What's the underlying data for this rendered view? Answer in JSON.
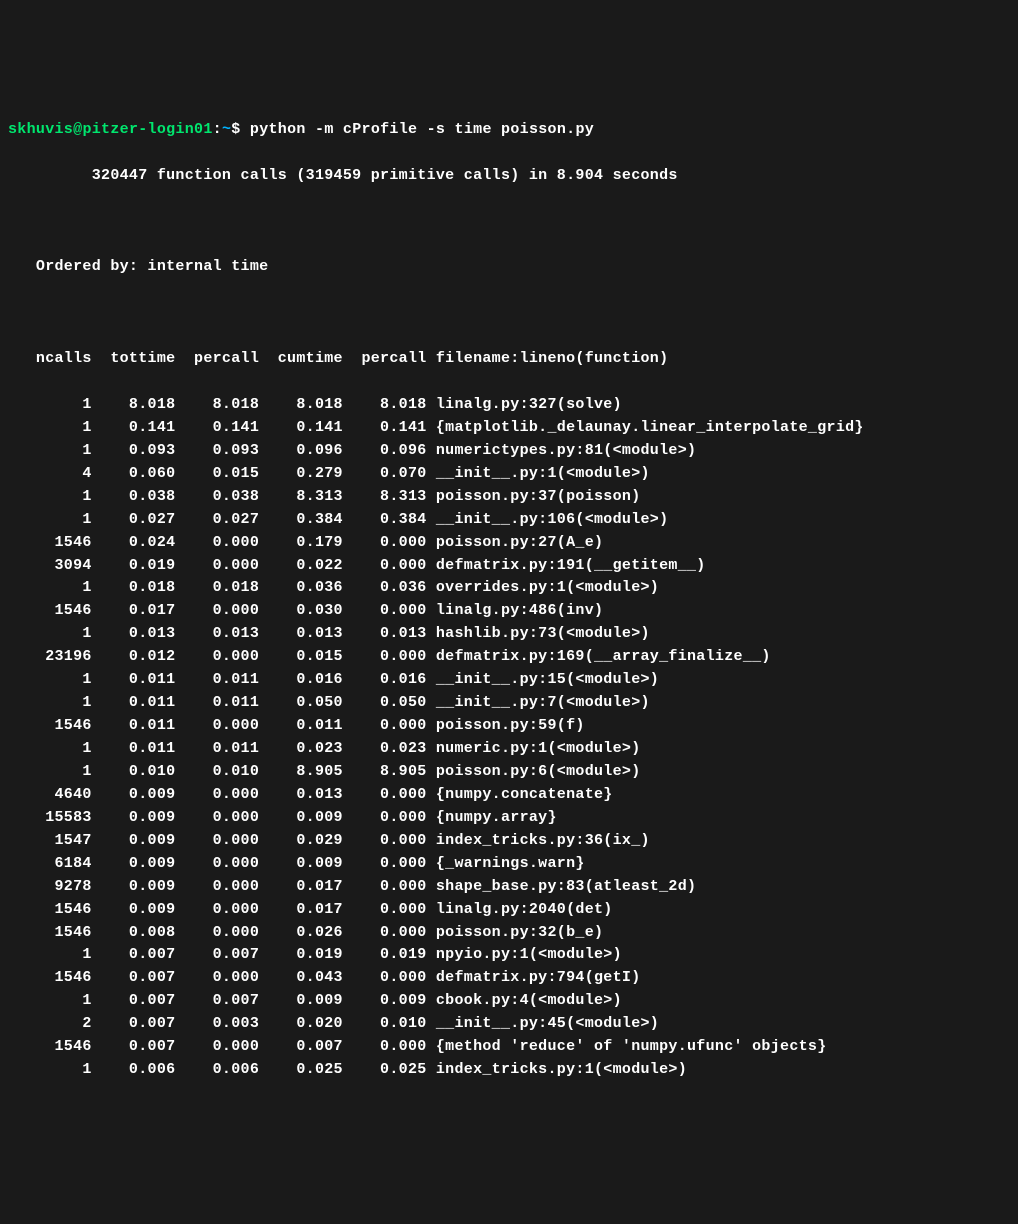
{
  "prompt": {
    "user": "skhuvis",
    "host": "pitzer-login01",
    "path": "~",
    "command": "python -m cProfile -s time poisson.py"
  },
  "summary": "         320447 function calls (319459 primitive calls) in 8.904 seconds",
  "ordered_by": "   Ordered by: internal time",
  "header": "   ncalls  tottime  percall  cumtime  percall filename:lineno(function)",
  "rows": [
    "        1    8.018    8.018    8.018    8.018 linalg.py:327(solve)",
    "        1    0.141    0.141    0.141    0.141 {matplotlib._delaunay.linear_interpolate_grid}",
    "        1    0.093    0.093    0.096    0.096 numerictypes.py:81(<module>)",
    "        4    0.060    0.015    0.279    0.070 __init__.py:1(<module>)",
    "        1    0.038    0.038    8.313    8.313 poisson.py:37(poisson)",
    "        1    0.027    0.027    0.384    0.384 __init__.py:106(<module>)",
    "     1546    0.024    0.000    0.179    0.000 poisson.py:27(A_e)",
    "     3094    0.019    0.000    0.022    0.000 defmatrix.py:191(__getitem__)",
    "        1    0.018    0.018    0.036    0.036 overrides.py:1(<module>)",
    "     1546    0.017    0.000    0.030    0.000 linalg.py:486(inv)",
    "        1    0.013    0.013    0.013    0.013 hashlib.py:73(<module>)",
    "    23196    0.012    0.000    0.015    0.000 defmatrix.py:169(__array_finalize__)",
    "        1    0.011    0.011    0.016    0.016 __init__.py:15(<module>)",
    "        1    0.011    0.011    0.050    0.050 __init__.py:7(<module>)",
    "     1546    0.011    0.000    0.011    0.000 poisson.py:59(f)",
    "        1    0.011    0.011    0.023    0.023 numeric.py:1(<module>)",
    "        1    0.010    0.010    8.905    8.905 poisson.py:6(<module>)",
    "     4640    0.009    0.000    0.013    0.000 {numpy.concatenate}",
    "    15583    0.009    0.000    0.009    0.000 {numpy.array}",
    "     1547    0.009    0.000    0.029    0.000 index_tricks.py:36(ix_)",
    "     6184    0.009    0.000    0.009    0.000 {_warnings.warn}",
    "     9278    0.009    0.000    0.017    0.000 shape_base.py:83(atleast_2d)",
    "     1546    0.009    0.000    0.017    0.000 linalg.py:2040(det)",
    "     1546    0.008    0.000    0.026    0.000 poisson.py:32(b_e)",
    "        1    0.007    0.007    0.019    0.019 npyio.py:1(<module>)",
    "     1546    0.007    0.000    0.043    0.000 defmatrix.py:794(getI)",
    "        1    0.007    0.007    0.009    0.009 cbook.py:4(<module>)",
    "        2    0.007    0.003    0.020    0.010 __init__.py:45(<module>)",
    "     1546    0.007    0.000    0.007    0.000 {method 'reduce' of 'numpy.ufunc' objects}",
    "        1    0.006    0.006    0.025    0.025 index_tricks.py:1(<module>)"
  ]
}
